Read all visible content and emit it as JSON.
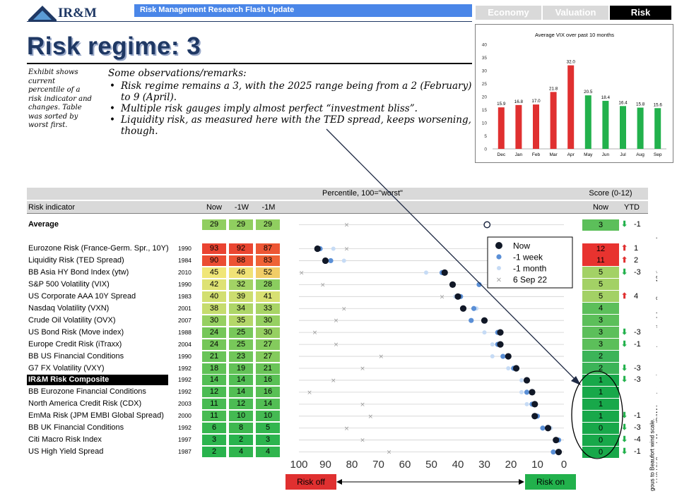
{
  "header": {
    "logo_text": "IR&M",
    "banner": "Risk Management Research Flash Update",
    "tabs": [
      "Economy",
      "Valuation",
      "Risk"
    ],
    "active_tab": "Risk"
  },
  "title": "Risk regime: 3",
  "exhibit_note": "Exhibit shows current percentile of a risk indicator and changes. Table was sorted by worst first.",
  "observations": {
    "title": "Some observations/remarks:",
    "items": [
      "Risk regime remains a 3, with the 2025 range being from a 2 (February) to 9 (April).",
      "Multiple risk gauges imply almost perfect “investment bliss”.",
      "Liquidity risk, as measured here with the TED spread, keeps worsening, though."
    ]
  },
  "chart_data": [
    {
      "type": "bar",
      "title": "Average VIX over past 10 months",
      "categories": [
        "Dec",
        "Jan",
        "Feb",
        "Mar",
        "Apr",
        "May",
        "Jun",
        "Jul",
        "Aug",
        "Sep"
      ],
      "values": [
        15.9,
        16.8,
        17.0,
        21.8,
        32.0,
        20.5,
        18.4,
        16.4,
        15.8,
        15.6
      ],
      "value_labels": [
        "15.9",
        "16.8",
        "17.0",
        "21.8",
        "32.0",
        "20.5",
        "18.4",
        "16.4",
        "15.8",
        "15.6"
      ],
      "colors": [
        "#e03030",
        "#e03030",
        "#e03030",
        "#e03030",
        "#e03030",
        "#22b14c",
        "#22b14c",
        "#22b14c",
        "#22b14c",
        "#22b14c"
      ],
      "ylim": [
        0,
        40
      ],
      "yticks": [
        "0",
        "5",
        "10",
        "15",
        "20",
        "25",
        "30",
        "35",
        "40"
      ]
    },
    {
      "type": "scatter",
      "xlabel": "",
      "xlim": [
        100,
        0
      ],
      "xticks": [
        "100",
        "90",
        "80",
        "70",
        "60",
        "50",
        "40",
        "30",
        "20",
        "10",
        "0"
      ],
      "legend": [
        "Now",
        "-1 week",
        "-1 month",
        "6 Sep 22"
      ],
      "legend_placement": "top-right"
    }
  ],
  "table": {
    "group_header": "Percentile, 100=\"worst\"",
    "score_header": "Score (0-12)",
    "col_indicator": "Risk indicator",
    "col_now": "Now",
    "col_1w": "-1W",
    "col_1m": "-1M",
    "col_score_now": "Now",
    "col_ytd": "YTD",
    "average": {
      "label": "Average",
      "now": 29,
      "w1": 29,
      "m1": 29,
      "score": 3,
      "ytd": "-1",
      "ytd_dir": "down",
      "x_ago": 82
    },
    "rows": [
      {
        "name": "Eurozone Risk (France-Germ. Spr., 10Y)",
        "year": "1990",
        "now": 93,
        "w1": 92,
        "m1": 87,
        "score": "12",
        "ytd": "1",
        "ytd_dir": "up",
        "x_ago": 82
      },
      {
        "name": "Liquidity Risk (TED Spread)",
        "year": "1984",
        "now": 90,
        "w1": 88,
        "m1": 83,
        "score": "11",
        "ytd": "2",
        "ytd_dir": "up",
        "x_ago": 22
      },
      {
        "name": "BB Asia HY Bond Index (ytw)",
        "year": "2010",
        "now": 45,
        "w1": 46,
        "m1": 52,
        "score": "5",
        "ytd": "-3",
        "ytd_dir": "down",
        "x_ago": 99
      },
      {
        "name": "S&P 500 Volatility (VIX)",
        "year": "1990",
        "now": 42,
        "w1": 32,
        "m1": 28,
        "score": "5",
        "ytd": "",
        "ytd_dir": "",
        "x_ago": 91
      },
      {
        "name": "US Corporate AAA 10Y Spread",
        "year": "1983",
        "now": 40,
        "w1": 39,
        "m1": 41,
        "score": "5",
        "ytd": "4",
        "ytd_dir": "up",
        "x_ago": 46
      },
      {
        "name": "Nasdaq Volatility (VXN)",
        "year": "2001",
        "now": 38,
        "w1": 34,
        "m1": 33,
        "score": "4",
        "ytd": "",
        "ytd_dir": "",
        "x_ago": 83
      },
      {
        "name": "Crude Oil Volatility (OVX)",
        "year": "2007",
        "now": 30,
        "w1": 35,
        "m1": 30,
        "score": "3",
        "ytd": "",
        "ytd_dir": "",
        "x_ago": 86
      },
      {
        "name": "US Bond Risk (Move index)",
        "year": "1988",
        "now": 24,
        "w1": 25,
        "m1": 30,
        "score": "3",
        "ytd": "-3",
        "ytd_dir": "down",
        "x_ago": 94
      },
      {
        "name": "Europe Credit Risk (iTraxx)",
        "year": "2004",
        "now": 24,
        "w1": 25,
        "m1": 27,
        "score": "3",
        "ytd": "-1",
        "ytd_dir": "down",
        "x_ago": 86
      },
      {
        "name": "BB US Financial Conditions",
        "year": "1990",
        "now": 21,
        "w1": 23,
        "m1": 27,
        "score": "2",
        "ytd": "",
        "ytd_dir": "",
        "x_ago": 69
      },
      {
        "name": "G7 FX Volatility (VXY)",
        "year": "1992",
        "now": 18,
        "w1": 19,
        "m1": 21,
        "score": "2",
        "ytd": "-3",
        "ytd_dir": "down",
        "x_ago": 76
      },
      {
        "name": "IR&M Risk Composite",
        "year": "1992",
        "now": 14,
        "w1": 14,
        "m1": 16,
        "score": "1",
        "ytd": "-3",
        "ytd_dir": "down",
        "x_ago": 87,
        "highlight": true
      },
      {
        "name": "BB Eurozone Financial Conditions",
        "year": "1992",
        "now": 12,
        "w1": 14,
        "m1": 16,
        "score": "1",
        "ytd": "",
        "ytd_dir": "",
        "x_ago": 96
      },
      {
        "name": "North America Credit Risk (CDX)",
        "year": "2003",
        "now": 11,
        "w1": 12,
        "m1": 14,
        "score": "1",
        "ytd": "",
        "ytd_dir": "",
        "x_ago": 76
      },
      {
        "name": "EmMa Risk (JPM EMBI Global Spread)",
        "year": "2000",
        "now": 11,
        "w1": 10,
        "m1": 10,
        "score": "1",
        "ytd": "-1",
        "ytd_dir": "down",
        "x_ago": 73
      },
      {
        "name": "BB UK Financial Conditions",
        "year": "1992",
        "now": 6,
        "w1": 8,
        "m1": 5,
        "score": "0",
        "ytd": "-3",
        "ytd_dir": "down",
        "x_ago": 82
      },
      {
        "name": "Citi Macro Risk Index",
        "year": "1997",
        "now": 3,
        "w1": 2,
        "m1": 3,
        "score": "0",
        "ytd": "-4",
        "ytd_dir": "down",
        "x_ago": 76
      },
      {
        "name": "US High Yield Spread",
        "year": "1987",
        "now": 2,
        "w1": 4,
        "m1": 4,
        "score": "0",
        "ytd": "-1",
        "ytd_dir": "down",
        "x_ago": 66
      }
    ],
    "risk_off_label": "Risk off",
    "risk_on_label": "Risk on"
  },
  "source_note": "Source: IR&M, Bloomberg. Notes: Percentile since year shown. Risk Composite is based on VIX, MOVE, VXY, and US HY Spread. Mom: IR&M long-term price momentum methodology. Score: 13-tier score analogous to Beaufort wind scale.",
  "colors": {
    "navy": "#1f3864",
    "banner_blue": "#4a86e8",
    "red": "#e03030",
    "green": "#22b14c"
  }
}
